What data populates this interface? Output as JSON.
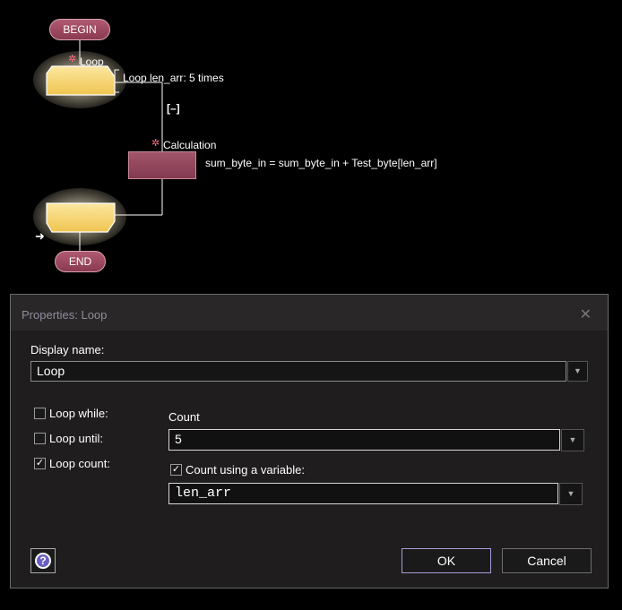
{
  "flowchart": {
    "begin_label": "BEGIN",
    "end_label": "END",
    "loop_title": "Loop",
    "loop_desc": "Loop len_arr: 5 times",
    "collapse_label": "[–]",
    "calc_title": "Calculation",
    "calc_desc": "sum_byte_in = sum_byte_in + Test_byte[len_arr]",
    "colors": {
      "pill": "#9b4a62",
      "loop_box": "#f2c95a",
      "calc_box": "#8f4358"
    }
  },
  "dialog": {
    "title": "Properties: Loop",
    "display_name_label": "Display name:",
    "display_name_value": "Loop",
    "options": [
      {
        "label": "Loop while:",
        "checked": false
      },
      {
        "label": "Loop until:",
        "checked": false
      },
      {
        "label": "Loop count:",
        "checked": true
      }
    ],
    "count_label": "Count",
    "count_value": "5",
    "count_var_label": "Count using a variable:",
    "count_var_checked": true,
    "count_var_value": "len_arr",
    "ok_label": "OK",
    "cancel_label": "Cancel",
    "help_icon": "question-mark-icon"
  }
}
